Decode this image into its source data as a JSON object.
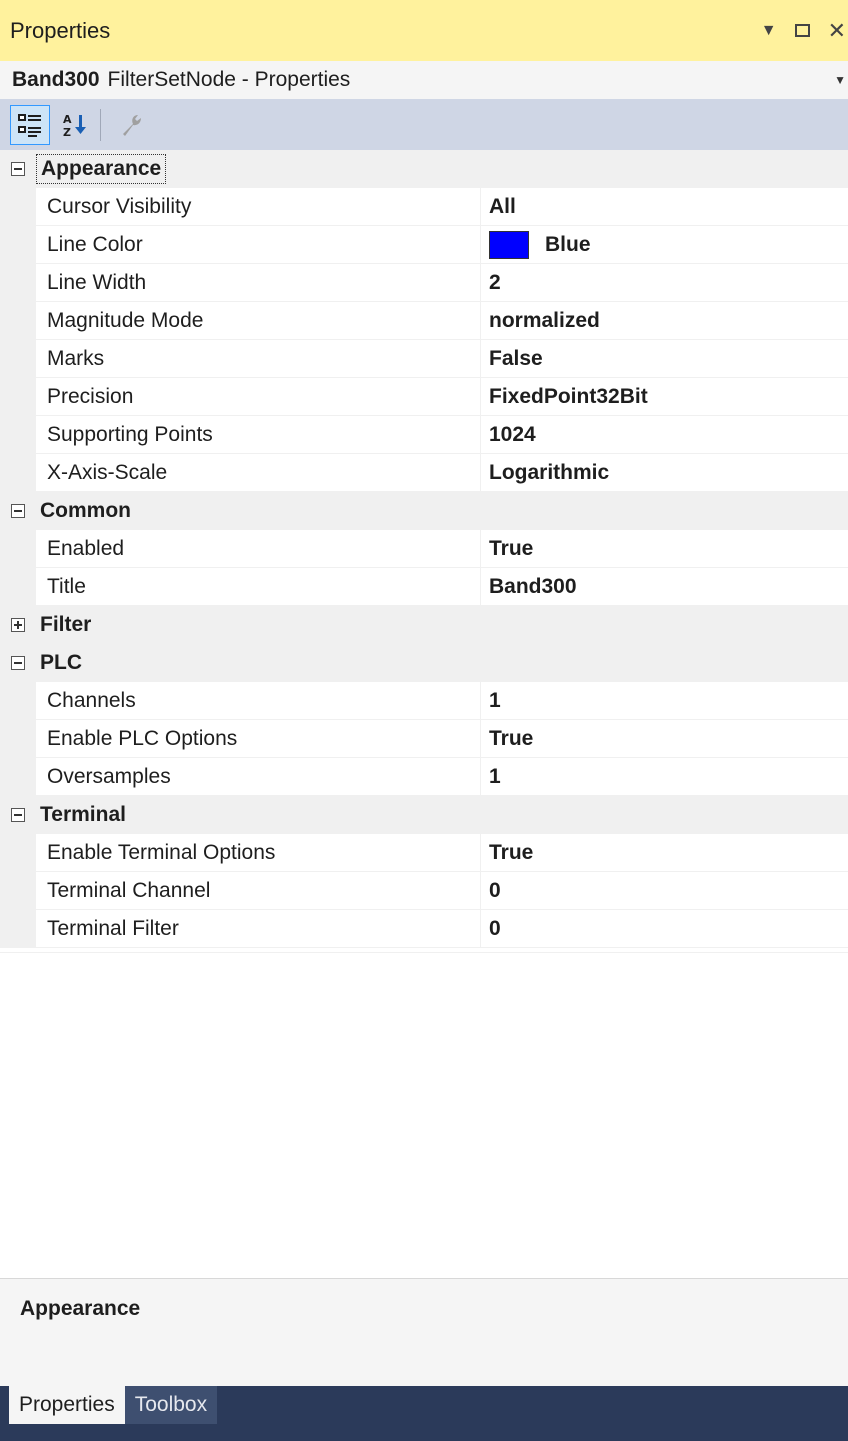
{
  "window": {
    "title": "Properties",
    "pin_icon": "dropdown-arrow-icon",
    "maximize_icon": "maximize-icon",
    "close_glyph": "✕"
  },
  "object_selector": {
    "name": "Band300",
    "type": "FilterSetNode - Properties"
  },
  "toolbar": {
    "buttons": [
      {
        "icon": "categorized-icon",
        "active": true
      },
      {
        "icon": "alphabetical-icon",
        "active": false
      },
      {
        "icon": "property-pages-icon",
        "active": false,
        "disabled": true
      }
    ]
  },
  "grid": {
    "categories": [
      {
        "label": "Appearance",
        "expanded": true,
        "properties": [
          {
            "name": "Cursor Visibility",
            "value": "All"
          },
          {
            "name": "Line Color",
            "value": "Blue",
            "color": "#0000ff"
          },
          {
            "name": "Line Width",
            "value": "2"
          },
          {
            "name": "Magnitude Mode",
            "value": "normalized"
          },
          {
            "name": "Marks",
            "value": "False"
          },
          {
            "name": "Precision",
            "value": "FixedPoint32Bit"
          },
          {
            "name": "Supporting Points",
            "value": "1024"
          },
          {
            "name": "X-Axis-Scale",
            "value": "Logarithmic"
          }
        ]
      },
      {
        "label": "Common",
        "expanded": true,
        "properties": [
          {
            "name": "Enabled",
            "value": "True"
          },
          {
            "name": "Title",
            "value": "Band300"
          }
        ]
      },
      {
        "label": "Filter",
        "expanded": false,
        "properties": []
      },
      {
        "label": "PLC",
        "expanded": true,
        "properties": [
          {
            "name": "Channels",
            "value": "1"
          },
          {
            "name": "Enable PLC Options",
            "value": "True"
          },
          {
            "name": "Oversamples",
            "value": "1"
          }
        ]
      },
      {
        "label": "Terminal",
        "expanded": true,
        "properties": [
          {
            "name": "Enable Terminal Options",
            "value": "True"
          },
          {
            "name": "Terminal Channel",
            "value": "0"
          },
          {
            "name": "Terminal Filter",
            "value": "0"
          }
        ]
      }
    ]
  },
  "description": {
    "title": "Appearance"
  },
  "tabs": [
    {
      "label": "Properties",
      "active": true
    },
    {
      "label": "Toolbox",
      "active": false
    }
  ],
  "colors": {
    "title_bar": "#fff29d",
    "toolbar": "#cfd6e5",
    "category_bg": "#f0f0f0",
    "tab_strip": "#2b3a5a",
    "line_color_swatch": "#0000ff"
  }
}
